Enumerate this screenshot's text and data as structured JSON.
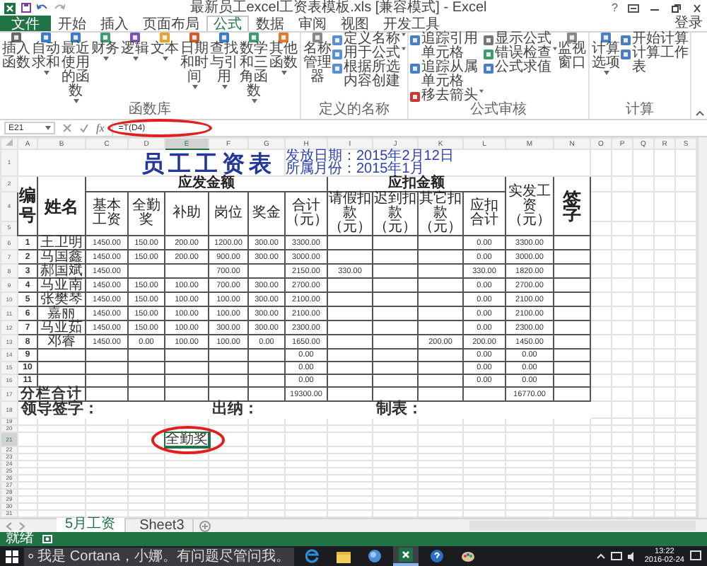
{
  "window": {
    "title": "最新员工excel工资表模板.xls [兼容模式] - Excel",
    "help": "?"
  },
  "ribbon_tabs": [
    {
      "label": "文件",
      "kind": "file",
      "selected": false
    },
    {
      "label": "开始",
      "kind": "tab",
      "selected": false
    },
    {
      "label": "插入",
      "kind": "tab",
      "selected": false
    },
    {
      "label": "页面布局",
      "kind": "tab",
      "selected": false
    },
    {
      "label": "公式",
      "kind": "tab",
      "selected": true
    },
    {
      "label": "数据",
      "kind": "tab",
      "selected": false
    },
    {
      "label": "审阅",
      "kind": "tab",
      "selected": false
    },
    {
      "label": "视图",
      "kind": "tab",
      "selected": false
    },
    {
      "label": "开发工具",
      "kind": "tab",
      "selected": false
    }
  ],
  "account": "登录",
  "ribbon_groups": [
    {
      "label": "函数库",
      "sections": [
        {
          "kind": "large",
          "items": [
            {
              "label": "插入函数",
              "dropdown": false
            },
            {
              "label": "自动求和",
              "dropdown": true
            },
            {
              "label": "最近使用的函数",
              "dropdown": true
            },
            {
              "label": "财务",
              "dropdown": true
            },
            {
              "label": "逻辑",
              "dropdown": true
            },
            {
              "label": "文本",
              "dropdown": true
            },
            {
              "label": "日期和时间",
              "dropdown": true
            },
            {
              "label": "查找与引用",
              "dropdown": true
            },
            {
              "label": "数学和三角函数",
              "dropdown": true
            },
            {
              "label": "其他函数",
              "dropdown": true
            }
          ]
        }
      ]
    },
    {
      "label": "定义的名称",
      "sections": [
        {
          "kind": "large",
          "items": [
            {
              "label": "名称管理器",
              "dropdown": false
            }
          ]
        },
        {
          "kind": "stack",
          "items": [
            {
              "label": "定义名称",
              "dropdown": true
            },
            {
              "label": "用于公式",
              "dropdown": true
            },
            {
              "label": "根据所选内容创建",
              "dropdown": false
            }
          ]
        }
      ]
    },
    {
      "label": "公式审核",
      "sections": [
        {
          "kind": "stack",
          "items": [
            {
              "label": "追踪引用单元格",
              "dropdown": false
            },
            {
              "label": "追踪从属单元格",
              "dropdown": false
            },
            {
              "label": "移去箭头",
              "dropdown": true
            }
          ]
        },
        {
          "kind": "stack",
          "items": [
            {
              "label": "显示公式",
              "dropdown": false
            },
            {
              "label": "错误检查",
              "dropdown": true
            },
            {
              "label": "公式求值",
              "dropdown": false
            }
          ]
        },
        {
          "kind": "large",
          "items": [
            {
              "label": "监视窗口",
              "dropdown": false
            }
          ]
        }
      ]
    },
    {
      "label": "计算",
      "sections": [
        {
          "kind": "large",
          "items": [
            {
              "label": "计算选项",
              "dropdown": true
            }
          ]
        },
        {
          "kind": "stack",
          "items": [
            {
              "label": "开始计算",
              "dropdown": false
            },
            {
              "label": "计算工作表",
              "dropdown": false
            }
          ]
        }
      ]
    }
  ],
  "formula_bar": {
    "name_box": "E21",
    "function_label": "fx",
    "formula": "=T(D4)"
  },
  "columns": [
    {
      "label": "A",
      "selected": false
    },
    {
      "label": "B",
      "selected": false
    },
    {
      "label": "C",
      "selected": false
    },
    {
      "label": "D",
      "selected": false
    },
    {
      "label": "E",
      "selected": true
    },
    {
      "label": "F",
      "selected": false
    },
    {
      "label": "G",
      "selected": false
    },
    {
      "label": "H",
      "selected": false
    },
    {
      "label": "I",
      "selected": false
    },
    {
      "label": "J",
      "selected": false
    },
    {
      "label": "K",
      "selected": false
    },
    {
      "label": "L",
      "selected": false
    },
    {
      "label": "M",
      "selected": false
    },
    {
      "label": "N",
      "selected": false
    },
    {
      "label": "O",
      "selected": false
    },
    {
      "label": "P",
      "selected": false
    },
    {
      "label": "Q",
      "selected": false
    },
    {
      "label": "R",
      "selected": false
    },
    {
      "label": "S",
      "selected": false
    }
  ],
  "rows": [
    {
      "kind": "title",
      "row": "1",
      "selected": false,
      "title": "员工工资表",
      "issue_date": "发放日期：2015年2月12日",
      "period": "所属月份：2015年1月"
    },
    {
      "kind": "group_header",
      "row": "2",
      "selected": false,
      "cells": {
        "A": "编号",
        "B": "姓名",
        "C": "应发金额",
        "I": "应扣金额",
        "M": "实发工资（元）",
        "N": "签字"
      }
    },
    {
      "kind": "column_header",
      "row": "4",
      "selected": false,
      "cells": {
        "C": "基本工资",
        "D": "全勤奖",
        "E": "补助",
        "F": "岗位",
        "G": "奖金",
        "H": "合计（元）",
        "I": "请假扣款（元）",
        "J": "迟到扣款（元）",
        "K": "其它扣款（元）",
        "L": "应扣合计"
      }
    },
    {
      "kind": "spacer",
      "row": "5",
      "selected": false
    },
    {
      "kind": "data",
      "row": "6",
      "selected": false,
      "cells": {
        "A": "1",
        "B": "王卫明",
        "C": "1450.00",
        "D": "150.00",
        "E": "200.00",
        "F": "1200.00",
        "G": "300.00",
        "H": "3300.00",
        "L": "0.00",
        "M": "3300.00"
      }
    },
    {
      "kind": "data",
      "row": "7",
      "selected": false,
      "cells": {
        "A": "2",
        "B": "马国鑫",
        "C": "1450.00",
        "D": "150.00",
        "E": "200.00",
        "F": "900.00",
        "G": "300.00",
        "H": "3000.00",
        "L": "0.00",
        "M": "3000.00"
      }
    },
    {
      "kind": "data",
      "row": "8",
      "selected": false,
      "cells": {
        "A": "3",
        "B": "郝国斌",
        "C": "1450.00",
        "F": "700.00",
        "H": "2150.00",
        "I": "330.00",
        "L": "330.00",
        "M": "1820.00"
      }
    },
    {
      "kind": "data",
      "row": "9",
      "selected": false,
      "cells": {
        "A": "4",
        "B": "马亚南",
        "C": "1450.00",
        "D": "150.00",
        "E": "100.00",
        "F": "700.00",
        "G": "300.00",
        "H": "2700.00",
        "L": "0.00",
        "M": "2700.00"
      }
    },
    {
      "kind": "data",
      "row": "10",
      "selected": false,
      "cells": {
        "A": "5",
        "B": "张樊琴",
        "C": "1450.00",
        "D": "150.00",
        "E": "100.00",
        "F": "100.00",
        "G": "300.00",
        "H": "2100.00",
        "L": "0.00",
        "M": "2100.00"
      }
    },
    {
      "kind": "data",
      "row": "11",
      "selected": false,
      "cells": {
        "A": "6",
        "B": "嘉丽",
        "C": "1450.00",
        "D": "150.00",
        "E": "100.00",
        "F": "100.00",
        "G": "300.00",
        "H": "2100.00",
        "L": "0.00",
        "M": "2100.00"
      }
    },
    {
      "kind": "data",
      "row": "12",
      "selected": false,
      "cells": {
        "A": "7",
        "B": "马亚茹",
        "C": "1450.00",
        "D": "150.00",
        "E": "100.00",
        "F": "300.00",
        "G": "300.00",
        "H": "2300.00",
        "L": "0.00",
        "M": "2300.00"
      }
    },
    {
      "kind": "data",
      "row": "13",
      "selected": false,
      "cells": {
        "A": "8",
        "B": "邓睿",
        "C": "1450.00",
        "D": "0.00",
        "E": "100.00",
        "F": "100.00",
        "G": "0.00",
        "H": "1650.00",
        "K": "200.00",
        "L": "200.00",
        "M": "1450.00"
      }
    },
    {
      "kind": "data",
      "row": "14",
      "selected": false,
      "cells": {
        "A": "9",
        "H": "0.00",
        "L": "0.00",
        "M": "0.00"
      }
    },
    {
      "kind": "data",
      "row": "15",
      "selected": false,
      "cells": {
        "A": "10",
        "H": "0.00",
        "L": "0.00",
        "M": "0.00"
      }
    },
    {
      "kind": "data",
      "row": "16",
      "selected": false,
      "cells": {
        "A": "11",
        "H": "0.00",
        "L": "0.00",
        "M": "0.00"
      }
    },
    {
      "kind": "total",
      "row": "17",
      "selected": false,
      "cells": {
        "A": "分栏合计",
        "H": "19300.00",
        "M": "16770.00"
      }
    },
    {
      "kind": "signatures",
      "row": "18",
      "selected": false,
      "cells": {
        "A": "领导签字：",
        "F": "出纳：",
        "J": "制表："
      }
    },
    {
      "kind": "blank",
      "row": "19",
      "selected": false
    },
    {
      "kind": "blank",
      "row": "20",
      "selected": false
    },
    {
      "kind": "blank",
      "row": "21",
      "selected": true,
      "cells": {
        "E": "全勤奖"
      }
    },
    {
      "kind": "blank",
      "row": "22",
      "selected": false
    },
    {
      "kind": "blank",
      "row": "23",
      "selected": false
    },
    {
      "kind": "blank",
      "row": "24",
      "selected": false
    },
    {
      "kind": "blank",
      "row": "25",
      "selected": false
    },
    {
      "kind": "blank",
      "row": "26",
      "selected": false
    },
    {
      "kind": "blank",
      "row": "27",
      "selected": false
    },
    {
      "kind": "blank",
      "row": "28",
      "selected": false
    },
    {
      "kind": "blank",
      "row": "29",
      "selected": false
    },
    {
      "kind": "blank",
      "row": "30",
      "selected": false
    },
    {
      "kind": "blank",
      "row": "31",
      "selected": false
    }
  ],
  "sheet_tabs": [
    {
      "label": "5月工资",
      "selected": true
    },
    {
      "label": "Sheet3",
      "selected": false
    }
  ],
  "status_bar": {
    "text": "就绪"
  },
  "taskbar": {
    "search": "我是 Cortana，小娜。有问题尽管问我。",
    "apps": [
      {
        "selected": false
      },
      {
        "selected": false
      },
      {
        "selected": false
      },
      {
        "selected": true
      },
      {
        "selected": false
      },
      {
        "selected": false
      }
    ],
    "time": "13:22",
    "date": "2016-02-24"
  }
}
